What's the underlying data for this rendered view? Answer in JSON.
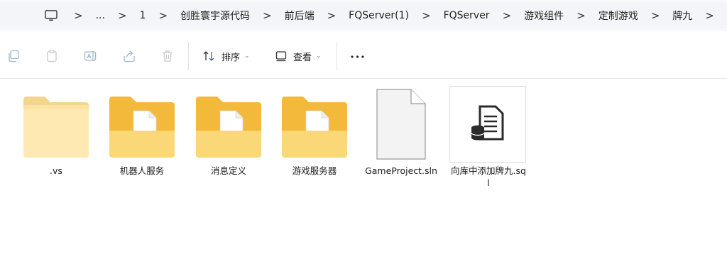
{
  "breadcrumb": {
    "items": [
      "...",
      "1",
      "创胜寰宇源代码",
      "前后端",
      "FQServer(1)",
      "FQServer",
      "游戏组件",
      "定制游戏",
      "牌九"
    ],
    "separator": ">"
  },
  "toolbar": {
    "sort_label": "排序",
    "view_label": "查看",
    "more_label": "•••"
  },
  "files": [
    {
      "name": ".vs",
      "type": "folder-plain"
    },
    {
      "name": "机器人服务",
      "type": "folder-doc"
    },
    {
      "name": "消息定义",
      "type": "folder-doc"
    },
    {
      "name": "游戏服务器",
      "type": "folder-doc"
    },
    {
      "name": "GameProject.sln",
      "type": "file-blank"
    },
    {
      "name": "向库中添加牌九.sql",
      "type": "file-sql"
    }
  ],
  "colors": {
    "folder_back": "#f2b93a",
    "folder_front": "#fbd877",
    "accent": "#1a1a1a"
  }
}
